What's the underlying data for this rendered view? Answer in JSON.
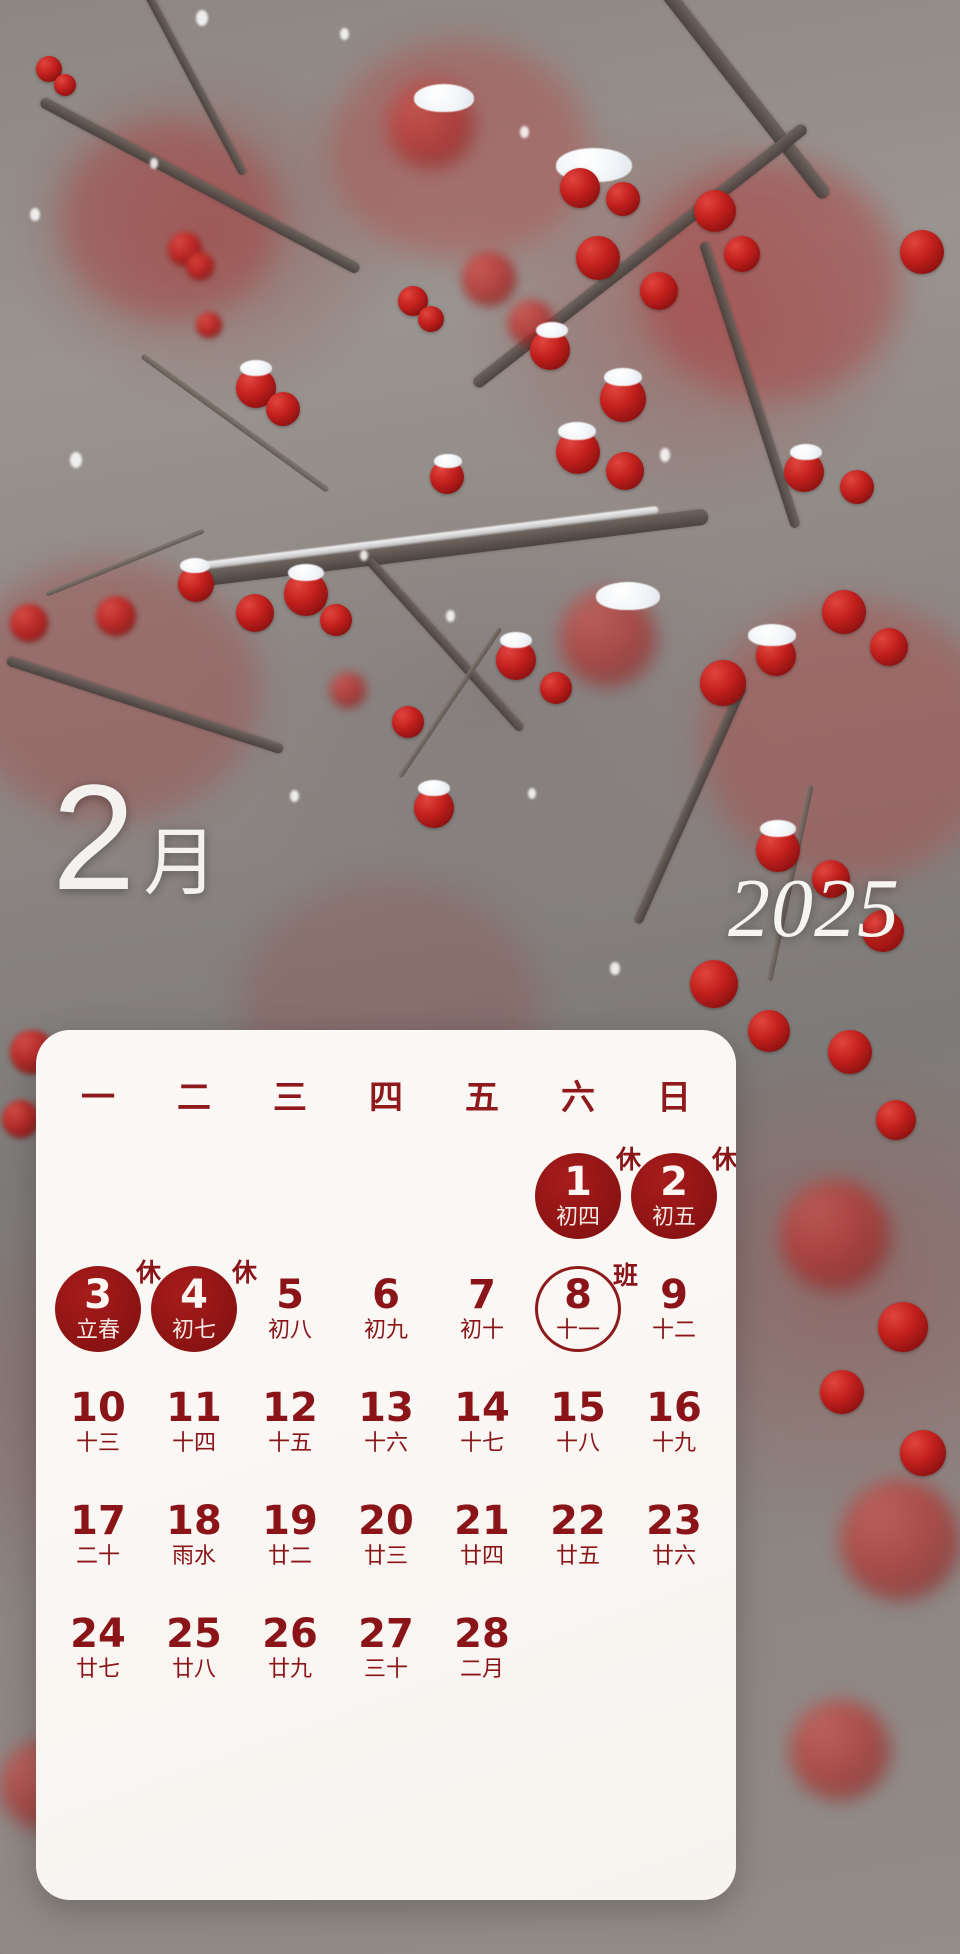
{
  "wallpaper": {
    "scene": "snow-covered-red-plum-blossom-branches",
    "accent_red": "#8f1a1c",
    "card_bg": "#faf7f4"
  },
  "header": {
    "month_number": "2",
    "month_suffix": "月",
    "year": "2025"
  },
  "calendar": {
    "weekdays": [
      "一",
      "二",
      "三",
      "四",
      "五",
      "六",
      "日"
    ],
    "weeks": [
      [
        {
          "day": "",
          "lunar": "",
          "style": "empty",
          "badge": ""
        },
        {
          "day": "",
          "lunar": "",
          "style": "empty",
          "badge": ""
        },
        {
          "day": "",
          "lunar": "",
          "style": "empty",
          "badge": ""
        },
        {
          "day": "",
          "lunar": "",
          "style": "empty",
          "badge": ""
        },
        {
          "day": "",
          "lunar": "",
          "style": "empty",
          "badge": ""
        },
        {
          "day": "1",
          "lunar": "初四",
          "style": "filled",
          "badge": "休"
        },
        {
          "day": "2",
          "lunar": "初五",
          "style": "filled",
          "badge": "休"
        }
      ],
      [
        {
          "day": "3",
          "lunar": "立春",
          "style": "filled",
          "badge": "休"
        },
        {
          "day": "4",
          "lunar": "初七",
          "style": "filled",
          "badge": "休"
        },
        {
          "day": "5",
          "lunar": "初八",
          "style": "plain",
          "badge": ""
        },
        {
          "day": "6",
          "lunar": "初九",
          "style": "plain",
          "badge": ""
        },
        {
          "day": "7",
          "lunar": "初十",
          "style": "plain",
          "badge": ""
        },
        {
          "day": "8",
          "lunar": "十一",
          "style": "outlined",
          "badge": "班"
        },
        {
          "day": "9",
          "lunar": "十二",
          "style": "plain",
          "badge": ""
        }
      ],
      [
        {
          "day": "10",
          "lunar": "十三",
          "style": "plain",
          "badge": ""
        },
        {
          "day": "11",
          "lunar": "十四",
          "style": "plain",
          "badge": ""
        },
        {
          "day": "12",
          "lunar": "十五",
          "style": "plain",
          "badge": ""
        },
        {
          "day": "13",
          "lunar": "十六",
          "style": "plain",
          "badge": ""
        },
        {
          "day": "14",
          "lunar": "十七",
          "style": "plain",
          "badge": ""
        },
        {
          "day": "15",
          "lunar": "十八",
          "style": "plain",
          "badge": ""
        },
        {
          "day": "16",
          "lunar": "十九",
          "style": "plain",
          "badge": ""
        }
      ],
      [
        {
          "day": "17",
          "lunar": "二十",
          "style": "plain",
          "badge": ""
        },
        {
          "day": "18",
          "lunar": "雨水",
          "style": "plain",
          "badge": ""
        },
        {
          "day": "19",
          "lunar": "廿二",
          "style": "plain",
          "badge": ""
        },
        {
          "day": "20",
          "lunar": "廿三",
          "style": "plain",
          "badge": ""
        },
        {
          "day": "21",
          "lunar": "廿四",
          "style": "plain",
          "badge": ""
        },
        {
          "day": "22",
          "lunar": "廿五",
          "style": "plain",
          "badge": ""
        },
        {
          "day": "23",
          "lunar": "廿六",
          "style": "plain",
          "badge": ""
        }
      ],
      [
        {
          "day": "24",
          "lunar": "廿七",
          "style": "plain",
          "badge": ""
        },
        {
          "day": "25",
          "lunar": "廿八",
          "style": "plain",
          "badge": ""
        },
        {
          "day": "26",
          "lunar": "廿九",
          "style": "plain",
          "badge": ""
        },
        {
          "day": "27",
          "lunar": "三十",
          "style": "plain",
          "badge": ""
        },
        {
          "day": "28",
          "lunar": "二月",
          "style": "plain",
          "badge": ""
        },
        {
          "day": "",
          "lunar": "",
          "style": "empty",
          "badge": ""
        },
        {
          "day": "",
          "lunar": "",
          "style": "empty",
          "badge": ""
        }
      ]
    ]
  }
}
